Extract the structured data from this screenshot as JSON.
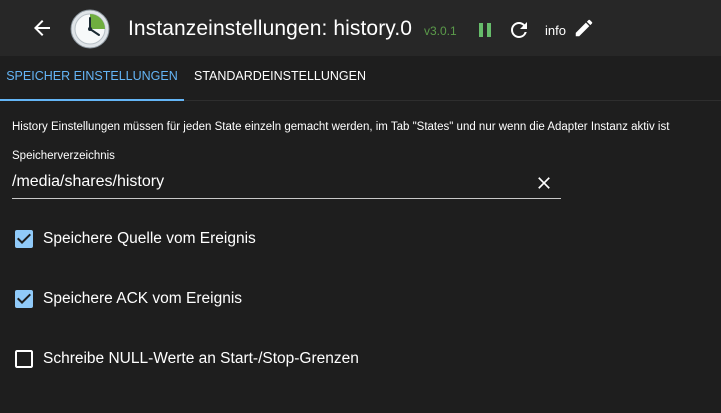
{
  "header": {
    "title": "Instanzeinstellungen: history.0",
    "version": "v3.0.1",
    "info_label": "info"
  },
  "icons": {
    "back": "arrow-left-icon",
    "logo": "clock-history-icon",
    "pause": "pause-icon",
    "reload": "reload-icon",
    "edit": "pencil-icon",
    "clear": "close-icon",
    "checkbox_checked": "checkbox-checked-icon",
    "checkbox_unchecked": "checkbox-unchecked-icon"
  },
  "colors": {
    "accent": "#64b5f6",
    "checkbox": "#90caf9",
    "version": "#5b9b4a",
    "pause": "#66bb6a",
    "background": "#1e1e1e",
    "topbar": "#272727"
  },
  "tabs": [
    {
      "label": "Speicher Einstellungen",
      "active": true
    },
    {
      "label": "Standardeinstellungen",
      "active": false
    }
  ],
  "content": {
    "hint": "History Einstellungen müssen für jeden State einzeln gemacht werden, im Tab \"States\" und nur wenn die Adapter Instanz aktiv ist",
    "storage_dir": {
      "label": "Speicherverzeichnis",
      "value": "/media/shares/history"
    },
    "checkboxes": [
      {
        "label": "Speichere Quelle vom Ereignis",
        "checked": true
      },
      {
        "label": "Speichere ACK vom Ereignis",
        "checked": true
      },
      {
        "label": "Schreibe NULL-Werte an Start-/Stop-Grenzen",
        "checked": false
      }
    ]
  }
}
